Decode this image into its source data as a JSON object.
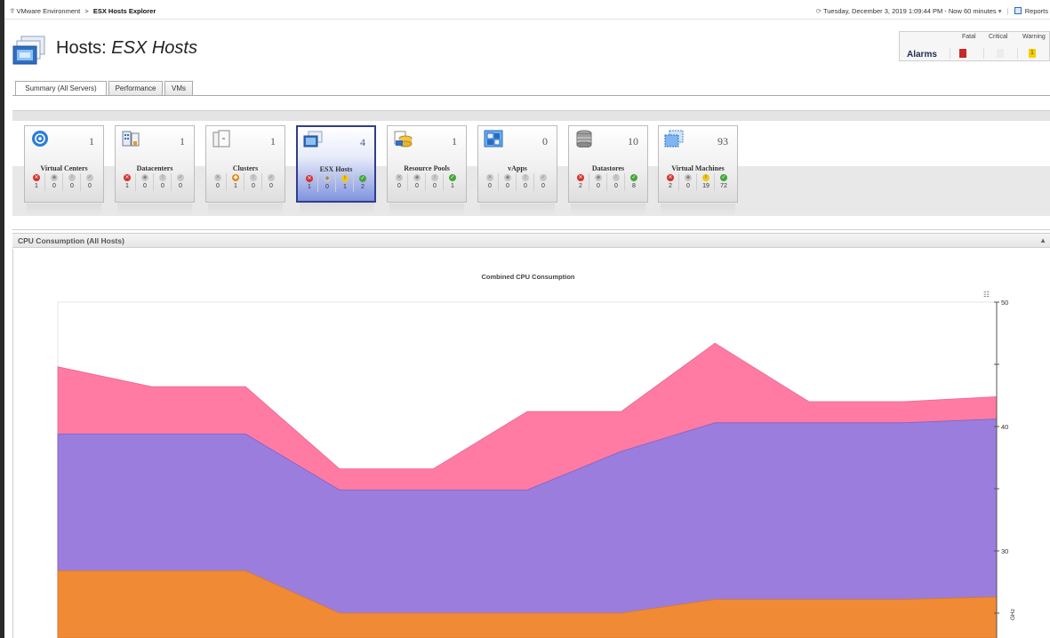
{
  "breadcrumb": {
    "root": "VMware Environment",
    "separator": ">",
    "current": "ESX Hosts Explorer"
  },
  "timebar": {
    "text": "Tuesday, December 3, 2019 1:09:44 PM - Now 60 minutes",
    "reports_label": "Reports"
  },
  "page": {
    "title_prefix": "Hosts:",
    "title_emphasis": "ESX Hosts"
  },
  "alarms": {
    "label": "Alarms",
    "headers": [
      "Fatal",
      "Critical",
      "Warning"
    ],
    "warning_count": "1",
    "fatal_color": "#c62a2a",
    "warning_color": "#f5d000"
  },
  "tabs": [
    "Summary (All Servers)",
    "Performance",
    "VMs"
  ],
  "tiles": [
    {
      "label": "Virtual Centers",
      "count": "1",
      "icon": "virtual-center-icon",
      "stats": [
        "1",
        "0",
        "0",
        "0"
      ]
    },
    {
      "label": "Datacenters",
      "count": "1",
      "icon": "datacenter-icon",
      "stats": [
        "1",
        "0",
        "0",
        "0"
      ]
    },
    {
      "label": "Clusters",
      "count": "1",
      "icon": "cluster-icon",
      "stats": [
        "0",
        "1",
        "0",
        "0"
      ]
    },
    {
      "label": "ESX Hosts",
      "count": "4",
      "icon": "esx-host-icon",
      "stats": [
        "1",
        "0",
        "1",
        "2"
      ]
    },
    {
      "label": "Resource Pools",
      "count": "1",
      "icon": "resource-pool-icon",
      "stats": [
        "0",
        "0",
        "0",
        "1"
      ]
    },
    {
      "label": "vApps",
      "count": "0",
      "icon": "vapp-icon",
      "stats": [
        "0",
        "0",
        "0",
        "0"
      ]
    },
    {
      "label": "Datastores",
      "count": "10",
      "icon": "datastore-icon",
      "stats": [
        "2",
        "0",
        "0",
        "8"
      ]
    },
    {
      "label": "Virtual Machines",
      "count": "93",
      "icon": "virtual-machine-icon",
      "stats": [
        "2",
        "0",
        "19",
        "72"
      ]
    }
  ],
  "cpu_section": {
    "title": "CPU Consumption (All Hosts)"
  },
  "chart_data": {
    "type": "area",
    "title": "Combined CPU Consumption",
    "ylabel": "GHz",
    "ylim": [
      25,
      50
    ],
    "yticks": [
      30,
      40,
      50
    ],
    "grid": false,
    "legend": "none",
    "x": [
      0,
      1,
      2,
      3,
      4,
      5,
      6,
      7,
      8,
      9,
      10
    ],
    "series": [
      {
        "color": "#f08a35",
        "values": [
          28.4,
          28.4,
          28.4,
          25.0,
          25.0,
          25.0,
          25.0,
          26.1,
          26.1,
          26.1,
          26.3
        ]
      },
      {
        "color": "#9a7ddd",
        "values": [
          39.4,
          39.4,
          39.4,
          34.9,
          34.9,
          34.9,
          38.0,
          40.3,
          40.3,
          40.3,
          40.6
        ]
      },
      {
        "color": "#ff7ba3",
        "values": [
          44.8,
          43.2,
          43.2,
          36.6,
          36.6,
          41.2,
          41.2,
          46.7,
          42.0,
          42.0,
          42.4
        ]
      }
    ],
    "x_labels_visible": false
  }
}
